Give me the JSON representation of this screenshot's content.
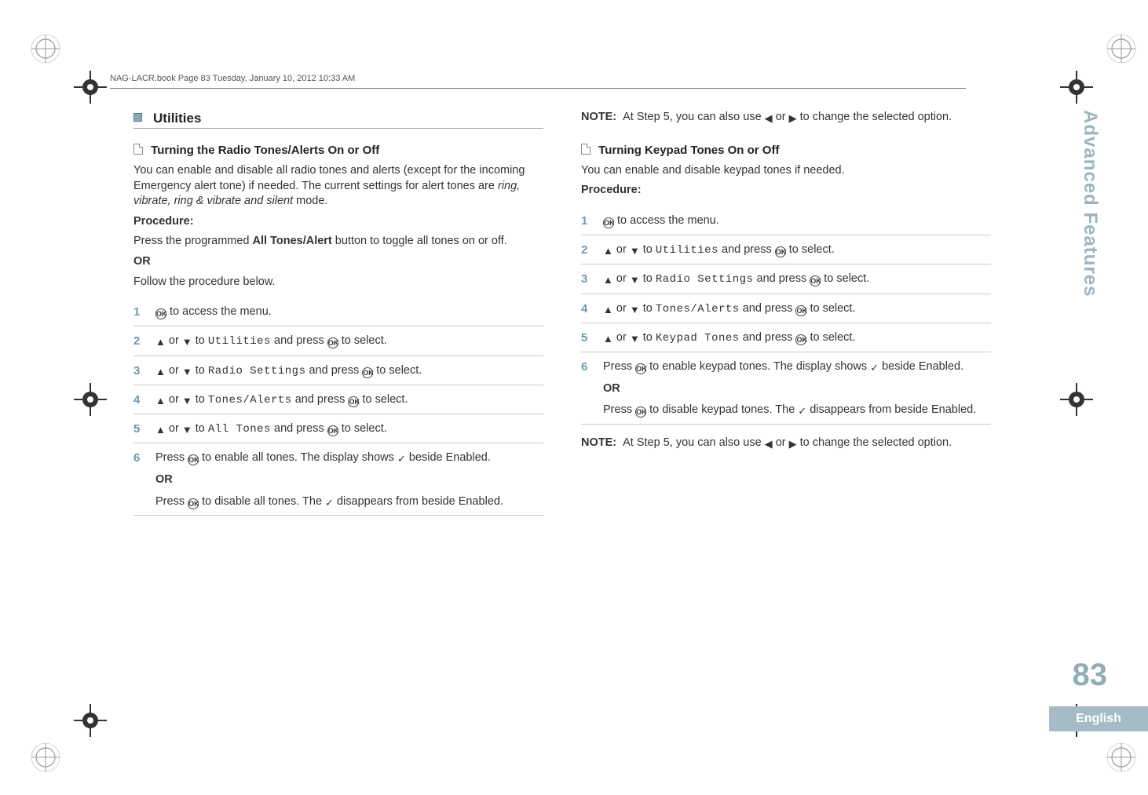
{
  "print": {
    "header": "NAG-LACR.book  Page 83  Tuesday, January 10, 2012  10:33 AM"
  },
  "sideTab": "Advanced Features",
  "pageNumber": "83",
  "language": "English",
  "left": {
    "section": "Utilities",
    "sub1": {
      "title": "Turning the Radio Tones/Alerts On or Off",
      "intro": "You can enable and disable all radio tones and alerts (except for the incoming Emergency alert tone) if needed. The current settings for alert tones are ",
      "introItalic": "ring, vibrate, ring & vibrate and silent",
      "introTail": " mode.",
      "procLabel": "Procedure:",
      "procLine1a": "Press the programmed ",
      "procLine1b": "All Tones/Alert",
      "procLine1c": " button to toggle all tones on or off.",
      "or": "OR",
      "procLine2": "Follow the procedure below.",
      "steps": {
        "s1": " to access the menu.",
        "s2a": " or ",
        "s2b": " to ",
        "s2menu": "Utilities",
        "s2c": " and press ",
        "s2d": " to select.",
        "s3menu": "Radio Settings",
        "s4menu": "Tones/Alerts",
        "s5menu": "All Tones",
        "s6a": "Press ",
        "s6b": " to enable all tones. The display shows ",
        "s6c": " beside Enabled.",
        "s6or": "OR",
        "s6d": "Press ",
        "s6e": " to disable all tones. The ",
        "s6f": " disappears from beside Enabled."
      }
    }
  },
  "right": {
    "noteTop": {
      "label": "NOTE:",
      "text": "At Step 5, you can also use ",
      "text2": " or ",
      "text3": " to change the selected option."
    },
    "sub2": {
      "title": "Turning Keypad Tones On or Off",
      "intro": "You can enable and disable keypad tones if needed.",
      "procLabel": "Procedure:",
      "steps": {
        "s1": " to access the menu.",
        "s2menu": "Utilities",
        "s3menu": "Radio Settings",
        "s4menu": "Tones/Alerts",
        "s5menu": "Keypad Tones",
        "navA": " or ",
        "navB": " to ",
        "navC": " and press ",
        "navD": " to select.",
        "s6a": "Press ",
        "s6b": " to enable keypad tones. The display shows ",
        "s6c": " beside Enabled.",
        "s6or": "OR",
        "s6d": "Press ",
        "s6e": " to disable keypad tones. The ",
        "s6f": " disappears from beside Enabled."
      }
    },
    "noteBottom": {
      "label": "NOTE:",
      "text": "At Step 5, you can also use ",
      "text2": " or ",
      "text3": " to change the selected option."
    }
  },
  "nums": {
    "n1": "1",
    "n2": "2",
    "n3": "3",
    "n4": "4",
    "n5": "5",
    "n6": "6"
  },
  "glyphs": {
    "ok": "OK",
    "up": "▲",
    "down": "▼",
    "left": "◀",
    "right": "▶",
    "check": "✓"
  }
}
